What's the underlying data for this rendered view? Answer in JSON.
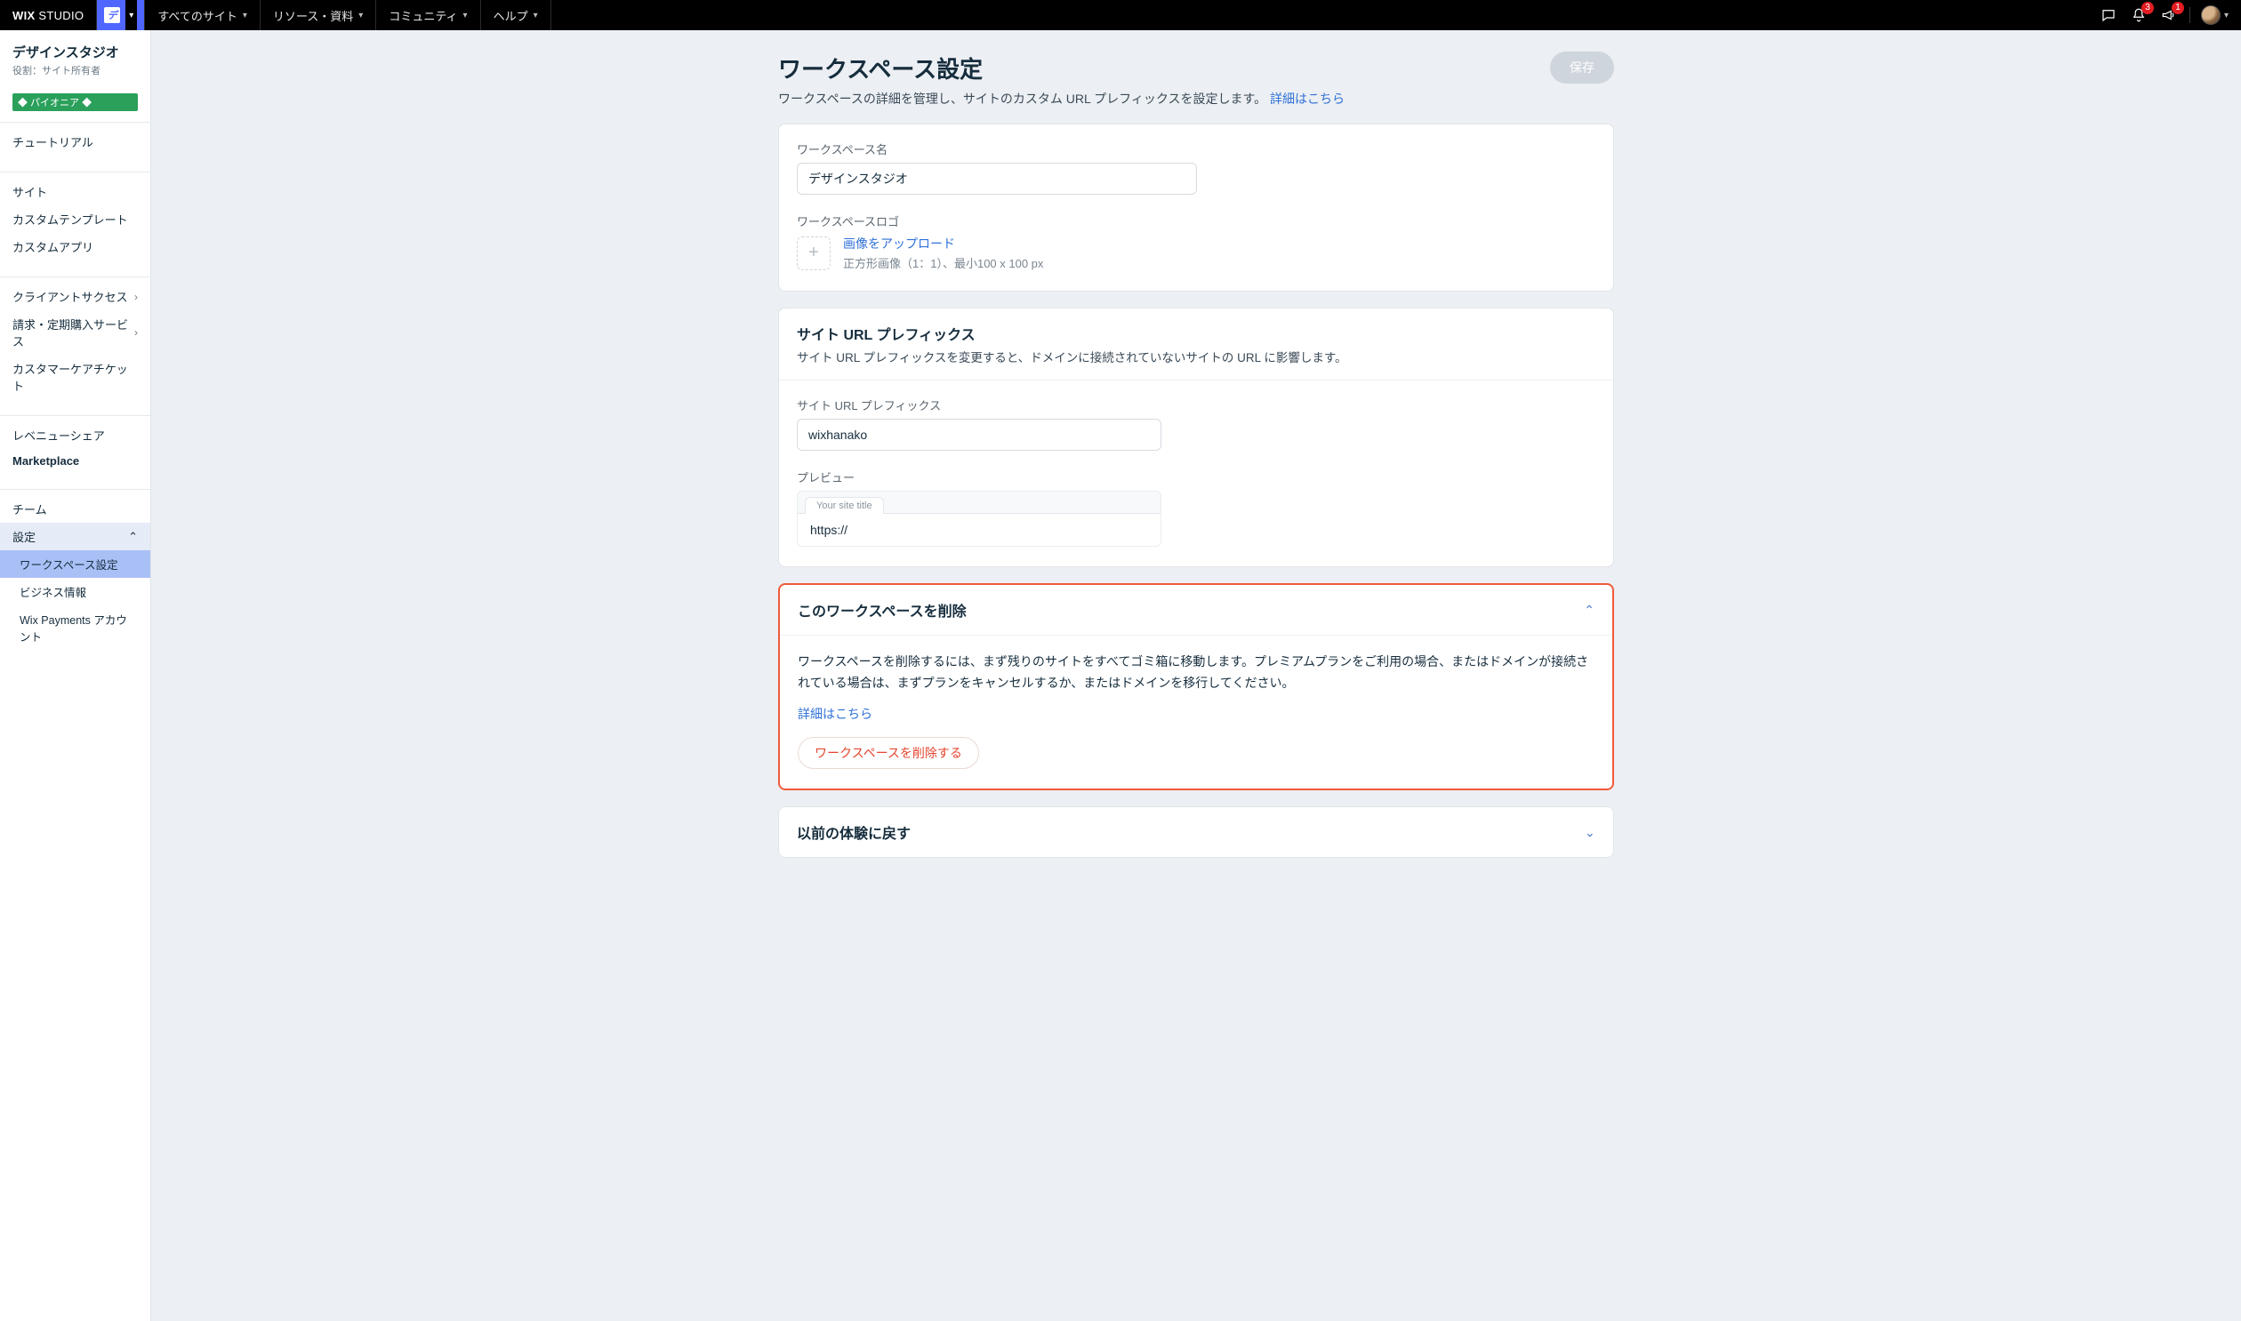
{
  "brand": {
    "wix": "WIX",
    "studio": " STUDIO"
  },
  "workspace_chip": {
    "initial": "デ"
  },
  "top_menu": [
    {
      "label": "すべてのサイト"
    },
    {
      "label": "リソース・資料"
    },
    {
      "label": "コミュニティ"
    },
    {
      "label": "ヘルプ"
    }
  ],
  "notifications": {
    "bell_badge": "3",
    "help_badge": "1"
  },
  "sidebar": {
    "workspace_name": "デザインスタジオ",
    "role_label": "役割：サイト所有者",
    "pioneer_badge": "◆ パイオニア ◆",
    "items": [
      {
        "label": "チュートリアル",
        "key": "tutorial"
      },
      {
        "label": "サイト",
        "key": "sites"
      },
      {
        "label": "カスタムテンプレート",
        "key": "custom-templates"
      },
      {
        "label": "カスタムアプリ",
        "key": "custom-apps"
      },
      {
        "label": "クライアントサクセス",
        "key": "client-success",
        "chev": true
      },
      {
        "label": "請求・定期購入サービス",
        "key": "billing",
        "chev": true
      },
      {
        "label": "カスタマーケアチケット",
        "key": "tickets"
      },
      {
        "label": "レベニューシェア",
        "key": "revenue-share"
      },
      {
        "label": "Marketplace",
        "key": "marketplace",
        "bold": true
      },
      {
        "label": "チーム",
        "key": "team"
      },
      {
        "label": "設定",
        "key": "settings",
        "expanded": true
      }
    ],
    "settings_sub": [
      {
        "label": "ワークスペース設定",
        "key": "workspace-settings",
        "active": true
      },
      {
        "label": "ビジネス情報",
        "key": "business-info"
      },
      {
        "label": "Wix Payments アカウント",
        "key": "wix-payments"
      }
    ]
  },
  "page": {
    "title": "ワークスペース設定",
    "subtitle": "ワークスペースの詳細を管理し、サイトのカスタム URL プレフィックスを設定します。",
    "learn_more": "詳細はこちら",
    "save_label": "保存"
  },
  "card_details": {
    "name_label": "ワークスペース名",
    "name_value": "デザインスタジオ",
    "logo_label": "ワークスペースロゴ",
    "upload_link": "画像をアップロード",
    "upload_hint": "正方形画像（1：1）、最小100 x 100 px"
  },
  "card_prefix": {
    "title": "サイト URL プレフィックス",
    "subtitle": "サイト URL プレフィックスを変更すると、ドメインに接続されていないサイトの URL に影響します。",
    "field_label": "サイト URL プレフィックス",
    "field_value": "wixhanako",
    "preview_label": "プレビュー",
    "preview_tab": "Your site title",
    "preview_protocol": "https://"
  },
  "card_delete": {
    "title": "このワークスペースを削除",
    "desc": "ワークスペースを削除するには、まず残りのサイトをすべてゴミ箱に移動します。プレミアムプランをご利用の場合、またはドメインが接続されている場合は、まずプランをキャンセルするか、またはドメインを移行してください。",
    "learn_more": "詳細はこちら",
    "delete_btn": "ワークスペースを削除する"
  },
  "card_revert": {
    "title": "以前の体験に戻す"
  }
}
